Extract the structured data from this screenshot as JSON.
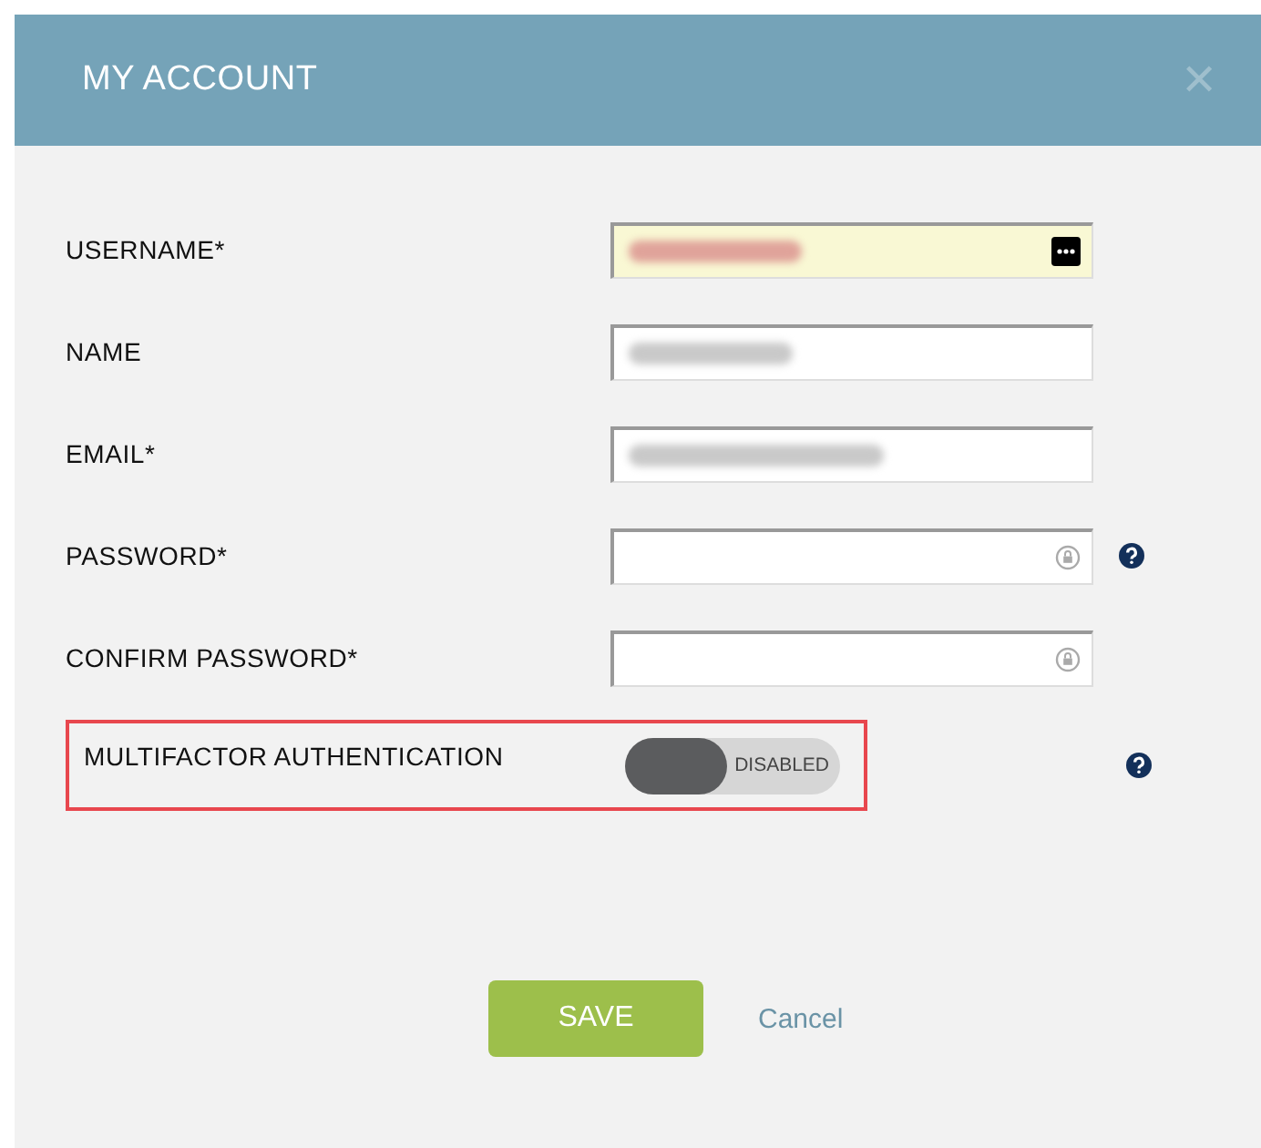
{
  "dialog": {
    "title": "MY ACCOUNT",
    "close": "✕"
  },
  "fields": [
    {
      "label": "USERNAME*",
      "kind": "text",
      "autofill": true,
      "blurred": true,
      "help": false,
      "has_menu": true
    },
    {
      "label": "NAME",
      "kind": "text",
      "autofill": false,
      "blurred": true,
      "help": false,
      "has_menu": false
    },
    {
      "label": "EMAIL*",
      "kind": "text",
      "autofill": false,
      "blurred": true,
      "help": false,
      "has_menu": false
    },
    {
      "label": "PASSWORD*",
      "kind": "password",
      "autofill": false,
      "blurred": false,
      "help": true,
      "has_menu": false
    },
    {
      "label": "CONFIRM PASSWORD*",
      "kind": "password",
      "autofill": false,
      "blurred": false,
      "help": false,
      "has_menu": false
    }
  ],
  "mfa": {
    "label": "MULTIFACTOR AUTHENTICATION",
    "state": "DISABLED",
    "on": false,
    "highlighted": true,
    "help": true
  },
  "buttons": {
    "save": "SAVE",
    "cancel": "Cancel"
  }
}
